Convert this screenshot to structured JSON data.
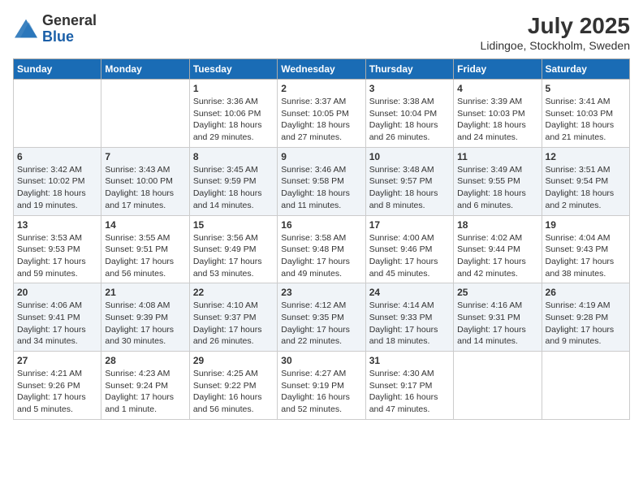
{
  "header": {
    "logo_general": "General",
    "logo_blue": "Blue",
    "month_year": "July 2025",
    "location": "Lidingoe, Stockholm, Sweden"
  },
  "days_of_week": [
    "Sunday",
    "Monday",
    "Tuesday",
    "Wednesday",
    "Thursday",
    "Friday",
    "Saturday"
  ],
  "weeks": [
    [
      {
        "day": "",
        "info": ""
      },
      {
        "day": "",
        "info": ""
      },
      {
        "day": "1",
        "info": "Sunrise: 3:36 AM\nSunset: 10:06 PM\nDaylight: 18 hours and 29 minutes."
      },
      {
        "day": "2",
        "info": "Sunrise: 3:37 AM\nSunset: 10:05 PM\nDaylight: 18 hours and 27 minutes."
      },
      {
        "day": "3",
        "info": "Sunrise: 3:38 AM\nSunset: 10:04 PM\nDaylight: 18 hours and 26 minutes."
      },
      {
        "day": "4",
        "info": "Sunrise: 3:39 AM\nSunset: 10:03 PM\nDaylight: 18 hours and 24 minutes."
      },
      {
        "day": "5",
        "info": "Sunrise: 3:41 AM\nSunset: 10:03 PM\nDaylight: 18 hours and 21 minutes."
      }
    ],
    [
      {
        "day": "6",
        "info": "Sunrise: 3:42 AM\nSunset: 10:02 PM\nDaylight: 18 hours and 19 minutes."
      },
      {
        "day": "7",
        "info": "Sunrise: 3:43 AM\nSunset: 10:00 PM\nDaylight: 18 hours and 17 minutes."
      },
      {
        "day": "8",
        "info": "Sunrise: 3:45 AM\nSunset: 9:59 PM\nDaylight: 18 hours and 14 minutes."
      },
      {
        "day": "9",
        "info": "Sunrise: 3:46 AM\nSunset: 9:58 PM\nDaylight: 18 hours and 11 minutes."
      },
      {
        "day": "10",
        "info": "Sunrise: 3:48 AM\nSunset: 9:57 PM\nDaylight: 18 hours and 8 minutes."
      },
      {
        "day": "11",
        "info": "Sunrise: 3:49 AM\nSunset: 9:55 PM\nDaylight: 18 hours and 6 minutes."
      },
      {
        "day": "12",
        "info": "Sunrise: 3:51 AM\nSunset: 9:54 PM\nDaylight: 18 hours and 2 minutes."
      }
    ],
    [
      {
        "day": "13",
        "info": "Sunrise: 3:53 AM\nSunset: 9:53 PM\nDaylight: 17 hours and 59 minutes."
      },
      {
        "day": "14",
        "info": "Sunrise: 3:55 AM\nSunset: 9:51 PM\nDaylight: 17 hours and 56 minutes."
      },
      {
        "day": "15",
        "info": "Sunrise: 3:56 AM\nSunset: 9:49 PM\nDaylight: 17 hours and 53 minutes."
      },
      {
        "day": "16",
        "info": "Sunrise: 3:58 AM\nSunset: 9:48 PM\nDaylight: 17 hours and 49 minutes."
      },
      {
        "day": "17",
        "info": "Sunrise: 4:00 AM\nSunset: 9:46 PM\nDaylight: 17 hours and 45 minutes."
      },
      {
        "day": "18",
        "info": "Sunrise: 4:02 AM\nSunset: 9:44 PM\nDaylight: 17 hours and 42 minutes."
      },
      {
        "day": "19",
        "info": "Sunrise: 4:04 AM\nSunset: 9:43 PM\nDaylight: 17 hours and 38 minutes."
      }
    ],
    [
      {
        "day": "20",
        "info": "Sunrise: 4:06 AM\nSunset: 9:41 PM\nDaylight: 17 hours and 34 minutes."
      },
      {
        "day": "21",
        "info": "Sunrise: 4:08 AM\nSunset: 9:39 PM\nDaylight: 17 hours and 30 minutes."
      },
      {
        "day": "22",
        "info": "Sunrise: 4:10 AM\nSunset: 9:37 PM\nDaylight: 17 hours and 26 minutes."
      },
      {
        "day": "23",
        "info": "Sunrise: 4:12 AM\nSunset: 9:35 PM\nDaylight: 17 hours and 22 minutes."
      },
      {
        "day": "24",
        "info": "Sunrise: 4:14 AM\nSunset: 9:33 PM\nDaylight: 17 hours and 18 minutes."
      },
      {
        "day": "25",
        "info": "Sunrise: 4:16 AM\nSunset: 9:31 PM\nDaylight: 17 hours and 14 minutes."
      },
      {
        "day": "26",
        "info": "Sunrise: 4:19 AM\nSunset: 9:28 PM\nDaylight: 17 hours and 9 minutes."
      }
    ],
    [
      {
        "day": "27",
        "info": "Sunrise: 4:21 AM\nSunset: 9:26 PM\nDaylight: 17 hours and 5 minutes."
      },
      {
        "day": "28",
        "info": "Sunrise: 4:23 AM\nSunset: 9:24 PM\nDaylight: 17 hours and 1 minute."
      },
      {
        "day": "29",
        "info": "Sunrise: 4:25 AM\nSunset: 9:22 PM\nDaylight: 16 hours and 56 minutes."
      },
      {
        "day": "30",
        "info": "Sunrise: 4:27 AM\nSunset: 9:19 PM\nDaylight: 16 hours and 52 minutes."
      },
      {
        "day": "31",
        "info": "Sunrise: 4:30 AM\nSunset: 9:17 PM\nDaylight: 16 hours and 47 minutes."
      },
      {
        "day": "",
        "info": ""
      },
      {
        "day": "",
        "info": ""
      }
    ]
  ]
}
